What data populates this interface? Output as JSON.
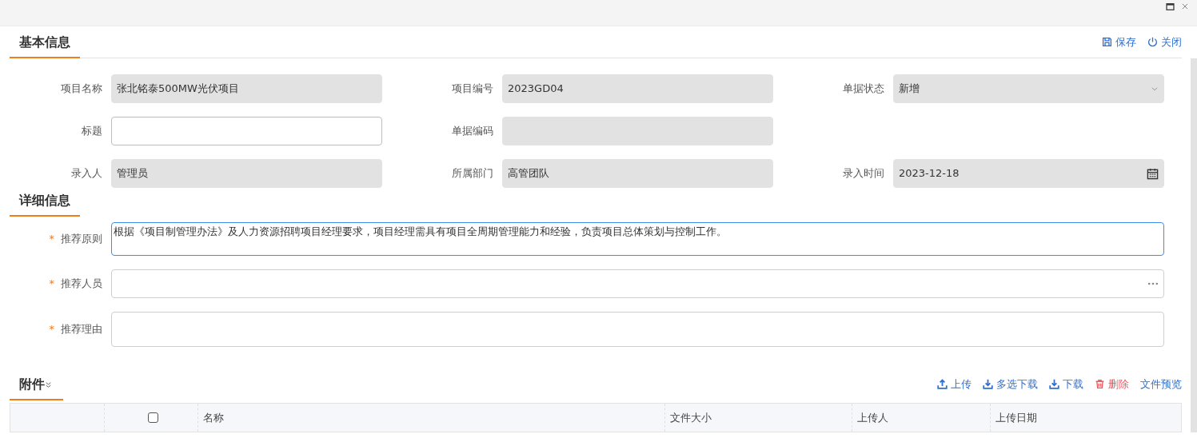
{
  "window": {
    "controls": [
      {
        "kind": "maximize"
      },
      {
        "kind": "close"
      }
    ]
  },
  "basic": {
    "title": "基本信息",
    "actions": [
      {
        "kind": "save",
        "label": "保存"
      },
      {
        "kind": "power",
        "label": "关闭"
      }
    ],
    "fields": [
      {
        "label": "项目名称",
        "value": "张北铭泰500MW光伏项目",
        "kind": "text",
        "readonly": true
      },
      {
        "label": "项目编号",
        "value": "2023GD04",
        "kind": "text",
        "readonly": true
      },
      {
        "label": "单据状态",
        "value": "新增",
        "kind": "select",
        "readonly": true
      },
      {
        "label": "标题",
        "kind": "text",
        "readonly": false
      },
      {
        "label": "单据编码",
        "kind": "text",
        "readonly": true
      },
      {
        "kind": "empty"
      },
      {
        "label": "录入人",
        "value": "管理员",
        "kind": "text",
        "readonly": true
      },
      {
        "label": "所属部门",
        "value": "高管团队",
        "kind": "text",
        "readonly": true
      },
      {
        "label": "录入时间",
        "value": "2023-12-18",
        "kind": "date",
        "readonly": true
      }
    ]
  },
  "detail": {
    "title": "详细信息",
    "fields": [
      {
        "label": "推荐原则",
        "required": true,
        "mark": "*",
        "value": "根据《项目制管理办法》及人力资源招聘项目经理要求，项目经理需具有项目全周期管理能力和经验，负责项目总体策划与控制工作。",
        "kind": "textarea",
        "focused": true
      },
      {
        "label": "推荐人员",
        "required": true,
        "mark": "*",
        "kind": "lookup",
        "focused": false
      },
      {
        "label": "推荐理由",
        "required": true,
        "mark": "*",
        "kind": "textarea",
        "focused": false
      }
    ]
  },
  "attachments": {
    "title": "附件",
    "actions": [
      {
        "kind": "upload",
        "label": "上传"
      },
      {
        "kind": "download",
        "label": "多选下载"
      },
      {
        "kind": "download",
        "label": "下载"
      },
      {
        "kind": "delete",
        "label": "删除"
      },
      {
        "kind": "none",
        "label": "文件预览"
      }
    ],
    "table": {
      "select_all": {
        "checked": false
      },
      "columns": [
        "名称",
        "文件大小",
        "上传人",
        "上传日期"
      ]
    }
  }
}
